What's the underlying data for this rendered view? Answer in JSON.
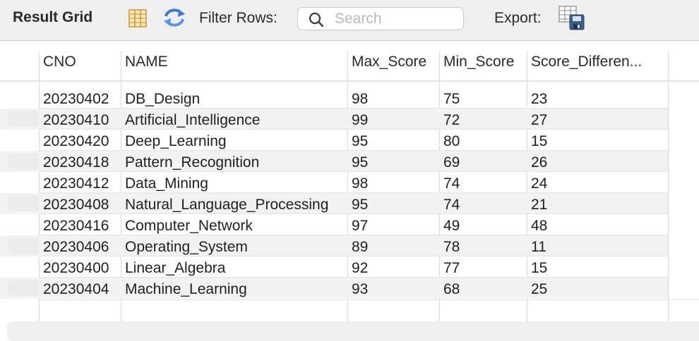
{
  "toolbar": {
    "title": "Result Grid",
    "filter_label": "Filter Rows:",
    "search_placeholder": "Search",
    "search_value": "",
    "export_label": "Export:"
  },
  "columns": [
    "CNO",
    "NAME",
    "Max_Score",
    "Min_Score",
    "Score_Differen..."
  ],
  "rows": [
    [
      "20230402",
      "DB_Design",
      "98",
      "75",
      "23"
    ],
    [
      "20230410",
      "Artificial_Intelligence",
      "99",
      "72",
      "27"
    ],
    [
      "20230420",
      "Deep_Learning",
      "95",
      "80",
      "15"
    ],
    [
      "20230418",
      "Pattern_Recognition",
      "95",
      "69",
      "26"
    ],
    [
      "20230412",
      "Data_Mining",
      "98",
      "74",
      "24"
    ],
    [
      "20230408",
      "Natural_Language_Processing",
      "95",
      "74",
      "21"
    ],
    [
      "20230416",
      "Computer_Network",
      "97",
      "49",
      "48"
    ],
    [
      "20230406",
      "Operating_System",
      "89",
      "78",
      "11"
    ],
    [
      "20230400",
      "Linear_Algebra",
      "92",
      "77",
      "15"
    ],
    [
      "20230404",
      "Machine_Learning",
      "93",
      "68",
      "25"
    ]
  ],
  "icons": {
    "grid_view": "grid-view-icon",
    "refresh": "refresh-icon",
    "search": "search-icon",
    "export": "export-icon"
  },
  "colors": {
    "toolbar_bg": "#efefef",
    "row_alt_bg": "#f2f2f2",
    "refresh_blue": "#3a7bd5",
    "grid_icon_orange": "#e0a43a"
  }
}
